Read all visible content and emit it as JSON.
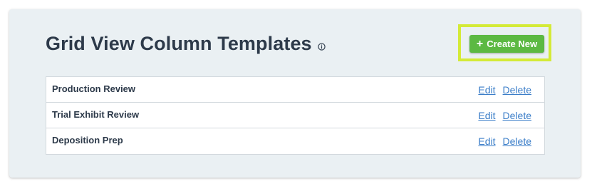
{
  "header": {
    "title": "Grid View Column Templates",
    "info_icon": "info-circle-icon"
  },
  "toolbar": {
    "create_label": "Create New",
    "create_icon": "plus-icon",
    "create_color": "#5cb942",
    "highlight_color": "#d4ea37"
  },
  "templates": [
    {
      "name": "Production Review",
      "edit_label": "Edit",
      "delete_label": "Delete"
    },
    {
      "name": "Trial Exhibit Review",
      "edit_label": "Edit",
      "delete_label": "Delete"
    },
    {
      "name": "Deposition Prep",
      "edit_label": "Edit",
      "delete_label": "Delete"
    }
  ]
}
